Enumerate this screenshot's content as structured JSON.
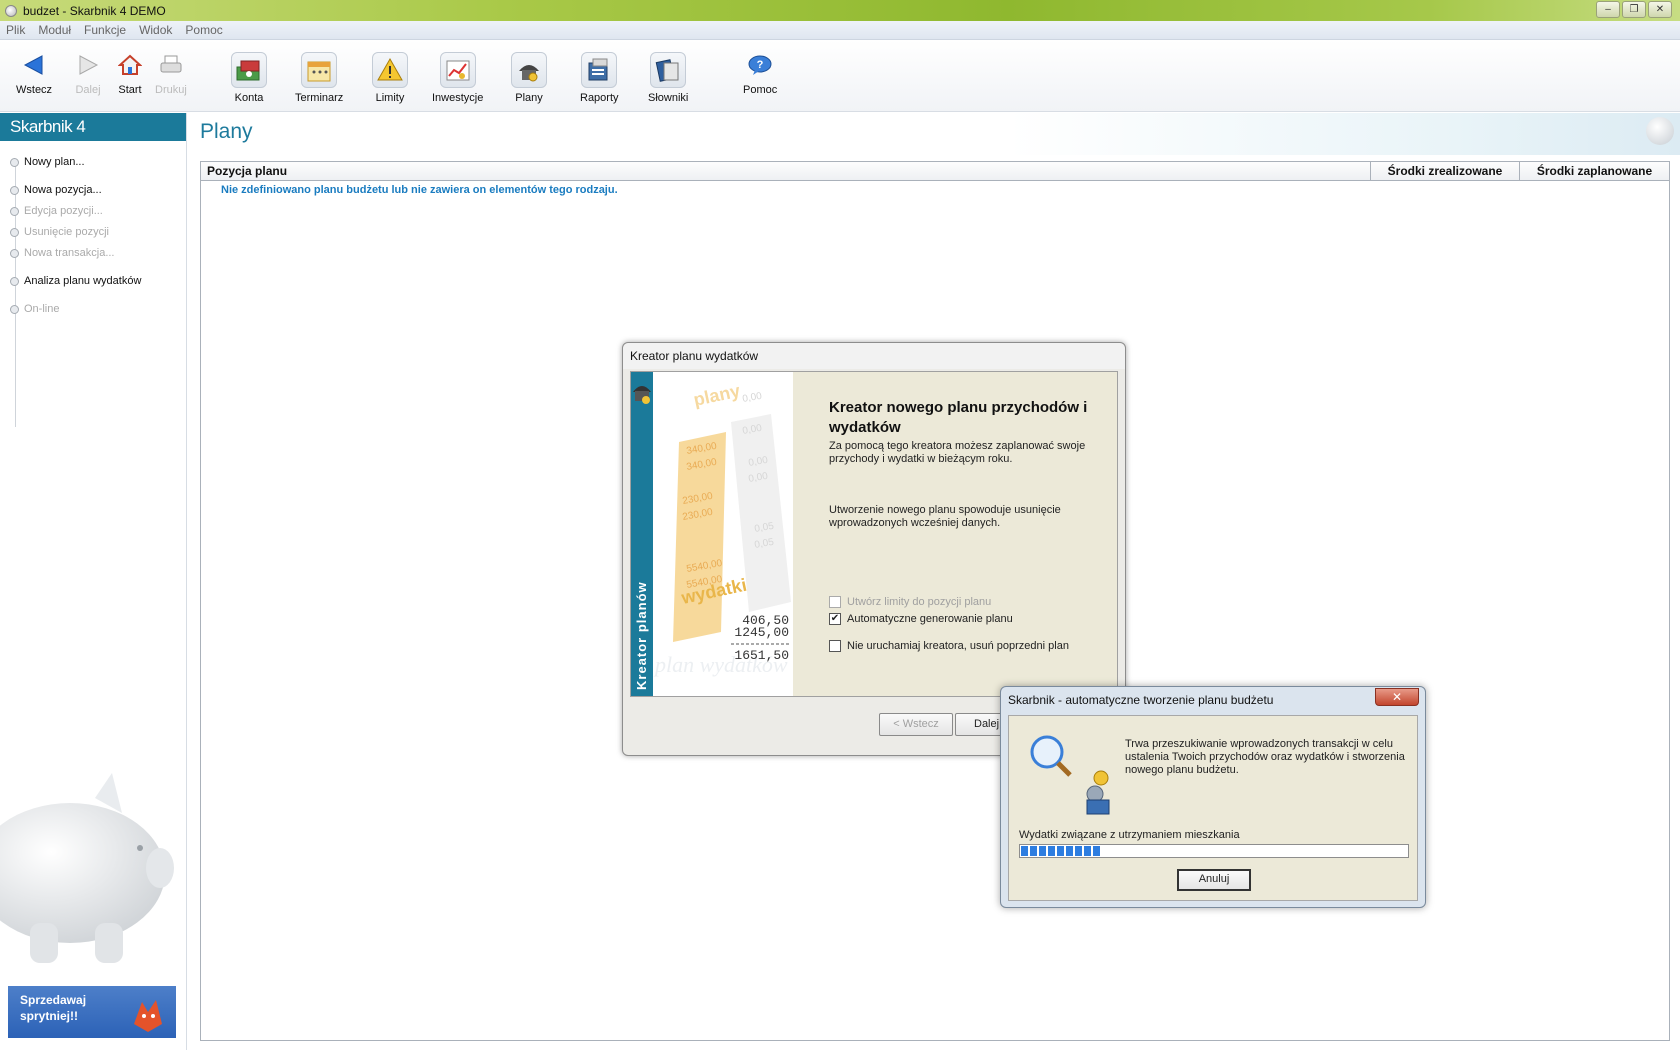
{
  "window": {
    "title": "budzet - Skarbnik 4 DEMO"
  },
  "menu": [
    "Plik",
    "Moduł",
    "Funkcje",
    "Widok",
    "Pomoc"
  ],
  "toolbar": {
    "back": "Wstecz",
    "forward": "Dalej",
    "start": "Start",
    "print": "Drukuj",
    "konta": "Konta",
    "terminarz": "Terminarz",
    "limity": "Limity",
    "inwestycje": "Inwestycje",
    "plany": "Plany",
    "raporty": "Raporty",
    "slowniki": "Słowniki",
    "pomoc": "Pomoc"
  },
  "sidebar": {
    "logo": "Skarbnik 4",
    "items": [
      {
        "label": "Nowy plan...",
        "enabled": true
      },
      {
        "label": "Nowa pozycja...",
        "enabled": true
      },
      {
        "label": "Edycja pozycji...",
        "enabled": false
      },
      {
        "label": "Usunięcie pozycji",
        "enabled": false
      },
      {
        "label": "Nowa transakcja...",
        "enabled": false
      },
      {
        "label": "Analiza planu wydatków",
        "enabled": true
      },
      {
        "label": "On-line",
        "enabled": false
      }
    ],
    "promo": [
      "Sprzedawaj",
      "sprytniej!!"
    ]
  },
  "main": {
    "title": "Plany",
    "columns": [
      "Pozycja planu",
      "Środki zrealizowane",
      "Środki zaplanowane"
    ],
    "empty_message": "Nie zdefiniowano planu budżetu lub nie zawiera on elementów tego rodzaju."
  },
  "wizard": {
    "title": "Kreator planu wydatków",
    "band": "Kreator planów",
    "art": {
      "word1": "plany",
      "word2": "wydatki",
      "word3": "plan wydatków",
      "orange_values": [
        "340,00",
        "340,00",
        "230,00",
        "230,00",
        "5540,00",
        "5540,00"
      ],
      "grey_values": [
        "0,00",
        "0,00",
        "0,00",
        "0,00",
        "0,05",
        "0,05"
      ],
      "totals": [
        "406,50",
        "1245,00",
        "1651,50"
      ]
    },
    "heading": "Kreator nowego planu przychodów i wydatków",
    "intro": "Za pomocą tego kreatora możesz zaplanować swoje przychody i wydatki w bieżącym roku.",
    "warning": "Utworzenie nowego planu spowoduje usunięcie wprowadzonych wcześniej danych.",
    "options": [
      {
        "label": "Utwórz limity do pozycji planu",
        "checked": false,
        "enabled": false
      },
      {
        "label": "Automatyczne generowanie planu",
        "checked": true,
        "enabled": true
      },
      {
        "label": "Nie uruchamiaj kreatora, usuń poprzedni plan",
        "checked": false,
        "enabled": true
      }
    ],
    "back_button": "< Wstecz",
    "next_button": "Dalej"
  },
  "progress_dialog": {
    "title": "Skarbnik - automatyczne tworzenie planu budżetu",
    "message": "Trwa przeszukiwanie wprowadzonych transakcji w celu ustalenia Twoich przychodów oraz wydatków i stworzenia nowego planu budżetu.",
    "task": "Wydatki związane z utrzymaniem mieszkania",
    "progress": 0.21,
    "cancel_button": "Anuluj",
    "close_label": "✕"
  },
  "colors": {
    "accent": "#1b7a9a",
    "link": "#1a7cc0",
    "progress": "#2d7de0"
  }
}
